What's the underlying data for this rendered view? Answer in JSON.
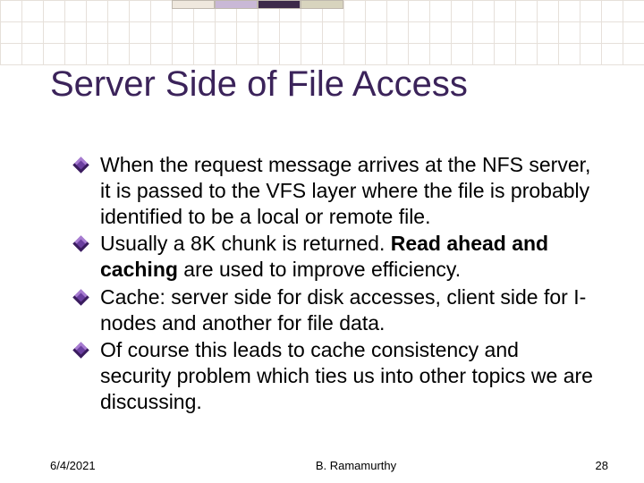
{
  "title": "Server Side of File Access",
  "bullets": [
    {
      "html": "When the request message arrives at the NFS server, it is passed to the VFS layer where the file is probably identified to be a local or remote file."
    },
    {
      "html": "Usually a 8K chunk is returned. <b>Read ahead and caching</b> are used to improve efficiency."
    },
    {
      "html": "Cache: server side for disk accesses, client side for I-nodes and another for file data."
    },
    {
      "html": "Of course this leads to cache consistency and security problem which ties us into other topics we are discussing."
    }
  ],
  "footer": {
    "date": "6/4/2021",
    "author": "B. Ramamurthy",
    "page": "28"
  },
  "colors": {
    "title": "#3b235a",
    "bullet_light": "#a77bd1",
    "bullet_mid": "#6b3fa0",
    "bullet_dark": "#3a1c5e"
  }
}
